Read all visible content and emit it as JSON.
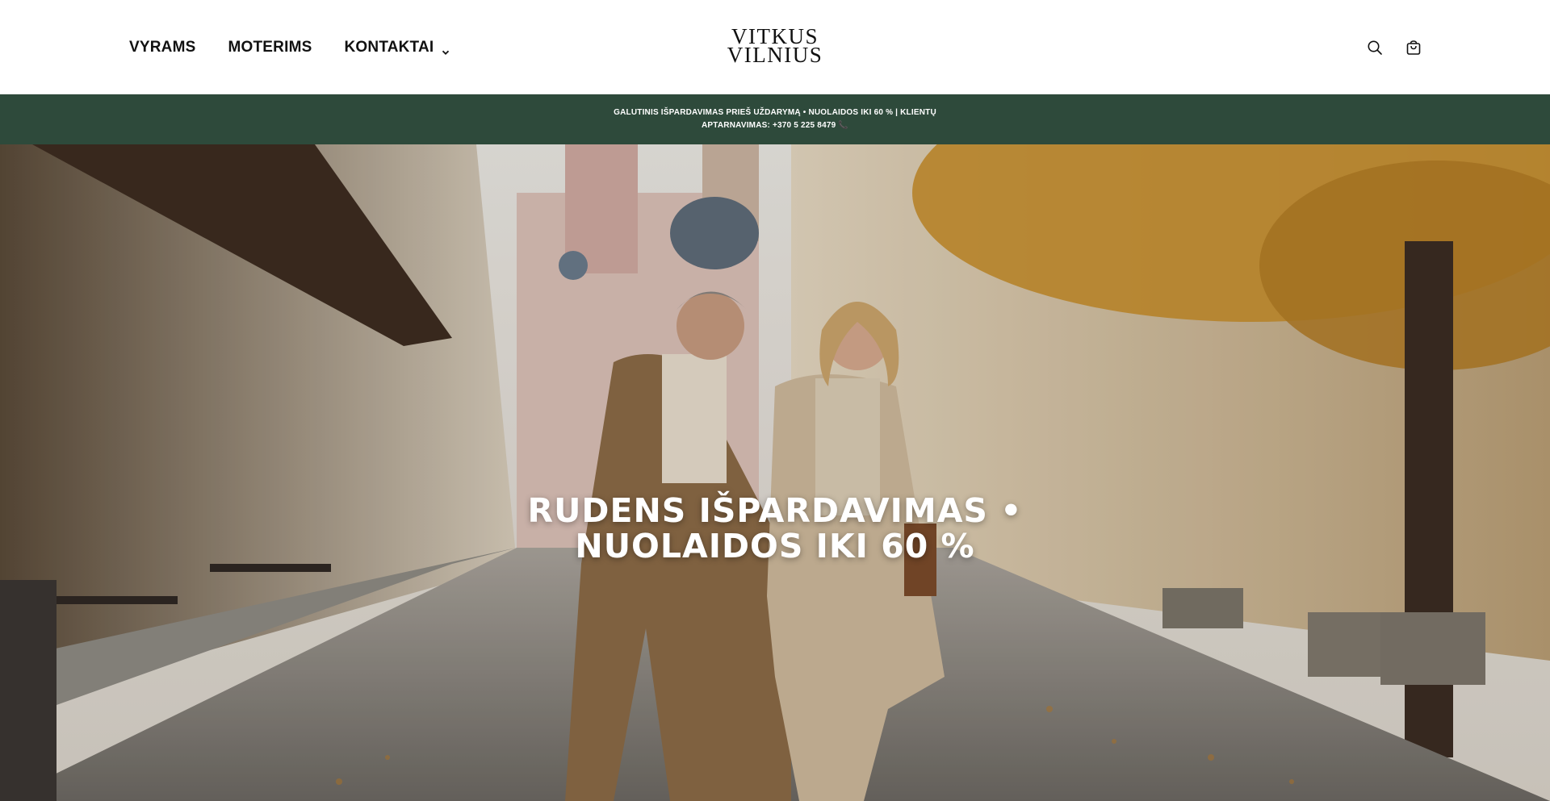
{
  "header": {
    "nav": [
      {
        "label": "VYRAMS"
      },
      {
        "label": "MOTERIMS"
      },
      {
        "label": "KONTAKTAI",
        "has_dropdown": true
      }
    ],
    "logo": {
      "line1": "VITKUS",
      "line2": "VILNIUS"
    },
    "icons": [
      "search-icon",
      "cart-icon"
    ]
  },
  "announcement": {
    "line1": "GALUTINIS IŠPARDAVIMAS PRIEŠ UŽDARYMĄ • NUOLAIDOS IKI 60 % | KLIENTŲ",
    "line2": "APTARNAVIMAS: +370 5 225 8479 📞",
    "background": "#2e4a3b"
  },
  "hero": {
    "title_line1": "RUDENS IŠPARDAVIMAS •",
    "title_line2": "NUOLAIDOS IKI 60 %"
  }
}
